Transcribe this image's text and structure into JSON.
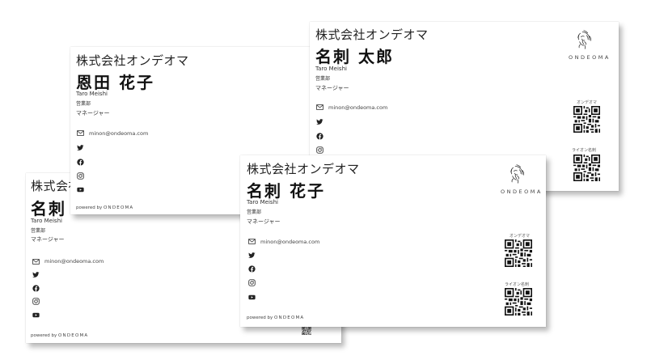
{
  "cards": [
    {
      "company": "株式会社オンデオマ",
      "name": "名刺",
      "romaji": "Taro Meishi",
      "department": "営業部",
      "title": "マネージャー",
      "email": "minon@ondeoma.com",
      "powered_prefix": "powered by",
      "powered_brand": "ONDEOMA",
      "qr_label": "",
      "brand": ""
    },
    {
      "company": "株式会社オンデオマ",
      "name": "恩田 花子",
      "romaji": "Taro Meishi",
      "department": "営業部",
      "title": "マネージャー",
      "email": "minon@ondeoma.com",
      "powered_prefix": "powered by",
      "powered_brand": "ONDEOMA",
      "qr_label": "",
      "brand": ""
    },
    {
      "company": "株式会社オンデオマ",
      "name": "名刺 太郎",
      "romaji": "Taro Meishi",
      "department": "営業部",
      "title": "マネージャー",
      "email": "minon@ondeoma.com",
      "powered_prefix": "",
      "powered_brand": "",
      "qr_label": "オンデオマ",
      "qr_label2": "ライオン名刺",
      "brand": "ONDEOMA"
    },
    {
      "company": "株式会社オンデオマ",
      "name": "名刺 花子",
      "romaji": "Taro Meishi",
      "department": "営業部",
      "title": "マネージャー",
      "email": "minon@ondeoma.com",
      "powered_prefix": "powered by",
      "powered_brand": "ONDEOMA",
      "qr_label": "オンデオマ",
      "qr_label2": "ライオン名刺",
      "brand": "ONDEOMA"
    }
  ],
  "icons": [
    "mail-icon",
    "twitter-icon",
    "facebook-icon",
    "instagram-icon",
    "youtube-icon",
    "lion-logo-icon",
    "qr-code-icon"
  ]
}
